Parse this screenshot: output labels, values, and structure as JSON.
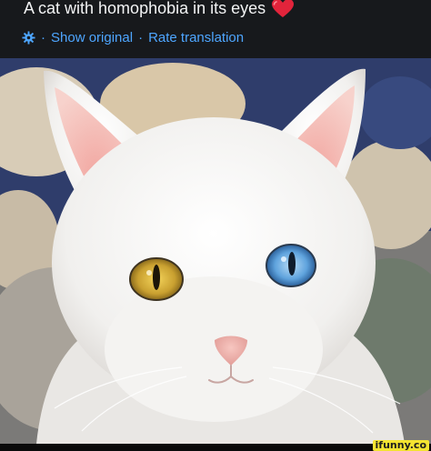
{
  "post": {
    "title": "A cat with homophobia in its eyes",
    "title_emoji_icon": "red-heart-icon",
    "actions": {
      "separator": "·",
      "show_original": "Show original",
      "rate_translation": "Rate translation"
    }
  },
  "image": {
    "subject": "white cat with heterochromia (one amber eye, one blue eye)"
  },
  "watermark": {
    "text": "ifunny.co"
  },
  "colors": {
    "header_bg": "#17191c",
    "title_text": "#f2f3f4",
    "link_blue": "#4ea6ff",
    "heart_red": "#e2243b",
    "watermark_bg": "#f4e431"
  }
}
